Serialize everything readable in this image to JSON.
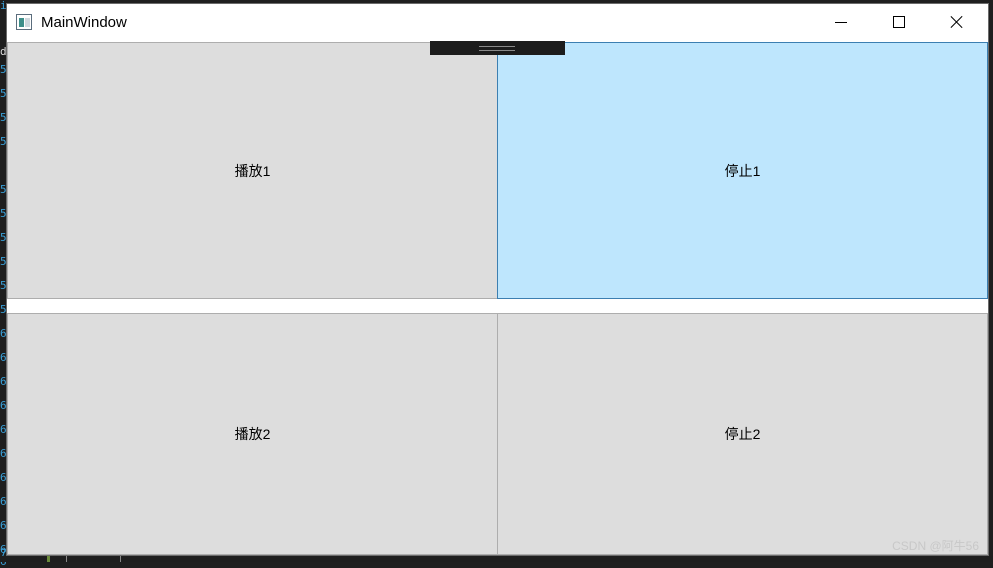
{
  "window": {
    "title": "MainWindow"
  },
  "buttons": {
    "play1": "播放1",
    "stop1": "停止1",
    "play2": "播放2",
    "stop2": "停止2"
  },
  "watermark": "CSDN @阿牛56",
  "background_line_digits": [
    "5",
    "5",
    "5",
    "5",
    "5",
    "5",
    "5",
    "5",
    "5",
    "5",
    "6",
    "6",
    "6",
    "6",
    "6",
    "6",
    "6",
    "6",
    "6",
    "6",
    "6",
    "7"
  ],
  "colors": {
    "button_face": "#dddddd",
    "button_hover": "#bee6fd",
    "button_hover_border": "#3c7fb1",
    "window_bg": "#ffffff",
    "line_number": "#3aa0d8"
  },
  "icons": {
    "app": "window-app-icon",
    "minimize": "minimize-icon",
    "maximize": "maximize-icon",
    "close": "close-icon"
  }
}
